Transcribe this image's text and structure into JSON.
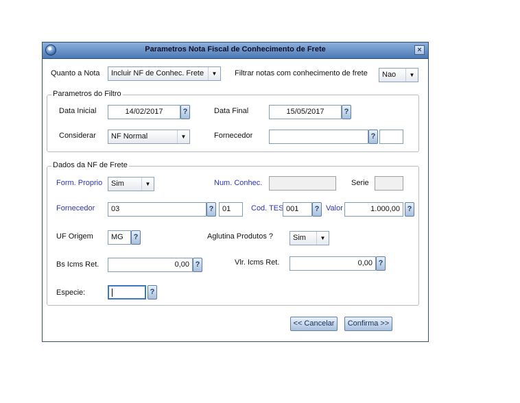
{
  "dialog": {
    "title": "Parametros Nota Fiscal de Conhecimento de Frete",
    "close": "×"
  },
  "top": {
    "quanto_label": "Quanto a Nota",
    "quanto_value": "Incluir NF de Conhec. Frete",
    "filtrar_label": "Filtrar notas com conhecimento de frete",
    "filtrar_value": "Nao"
  },
  "filtro": {
    "legend": "Parametros do Filtro",
    "data_inicial_label": "Data Inicial",
    "data_inicial": "14/02/2017",
    "data_final_label": "Data Final",
    "data_final": "15/05/2017",
    "considerar_label": "Considerar",
    "considerar_value": "NF Normal",
    "fornecedor_label": "Fornecedor",
    "fornecedor": "",
    "fornecedor_loja": ""
  },
  "dados": {
    "legend": "Dados da NF de Frete",
    "form_proprio_label": "Form. Proprio",
    "form_proprio": "Sim",
    "num_conhec_label": "Num. Conhec.",
    "num_conhec": "",
    "serie_label": "Serie",
    "serie": "",
    "fornecedor_label": "Fornecedor",
    "fornecedor": "03",
    "loja": "01",
    "cod_tes_label": "Cod. TES",
    "cod_tes": "001",
    "valor_label": "Valor",
    "valor": "1.000,00",
    "uf_origem_label": "UF Origem",
    "uf_origem": "MG",
    "aglutina_label": "Aglutina Produtos ?",
    "aglutina": "Sim",
    "bs_icms_label": "Bs Icms Ret.",
    "bs_icms": "0,00",
    "vlr_icms_label": "Vlr. Icms Ret.",
    "vlr_icms": "0,00",
    "especie_label": "Especie:",
    "especie": ""
  },
  "buttons": {
    "cancelar": "<< Cancelar",
    "confirma": "Confirma >>"
  },
  "icons": {
    "lookup": "?",
    "dropdown": "▼"
  }
}
